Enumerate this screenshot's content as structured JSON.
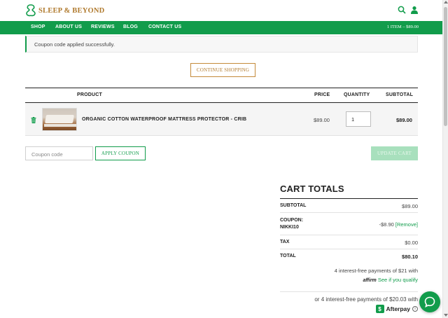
{
  "brand": {
    "logo_text": "SLEEP & BEYOND",
    "accent_color": "#119c4b",
    "gold_color": "#b07a2e"
  },
  "header": {
    "icons": [
      "search-icon",
      "user-icon"
    ]
  },
  "nav": {
    "items": [
      "SHOP",
      "ABOUT US",
      "REVIEWS",
      "BLOG",
      "CONTACT US"
    ],
    "cart_summary": "1 ITEM – $89.00"
  },
  "notice": {
    "message": "Coupon code applied successfully."
  },
  "buttons": {
    "continue_shopping": "CONTINUE SHOPPING",
    "apply_coupon": "APPLY COUPON",
    "update_cart": "UPDATE CART"
  },
  "cart_table": {
    "headers": {
      "product": "PRODUCT",
      "price": "PRICE",
      "quantity": "QUANTITY",
      "subtotal": "SUBTOTAL"
    },
    "rows": [
      {
        "name": "ORGANIC COTTON WATERPROOF MATTRESS PROTECTOR - CRIB",
        "price": "$89.00",
        "quantity": "1",
        "subtotal": "$89.00"
      }
    ]
  },
  "coupon": {
    "placeholder": "Coupon code"
  },
  "totals": {
    "title": "CART TOTALS",
    "subtotal_label": "SUBTOTAL",
    "subtotal_value": "$89.00",
    "coupon_label_1": "COUPON:",
    "coupon_label_2": "NIKKI10",
    "coupon_value": "-$8.90",
    "coupon_remove": "[Remove]",
    "tax_label": "TAX",
    "tax_value": "$0.00",
    "total_label": "TOTAL",
    "total_value": "$80.10"
  },
  "affirm": {
    "line1": "4 interest-free payments of $21 with",
    "logo": "affirm",
    "link": "See if you qualify"
  },
  "afterpay": {
    "line1": "or 4 interest-free payments of $20.03 with",
    "brand": "Afterpay"
  }
}
